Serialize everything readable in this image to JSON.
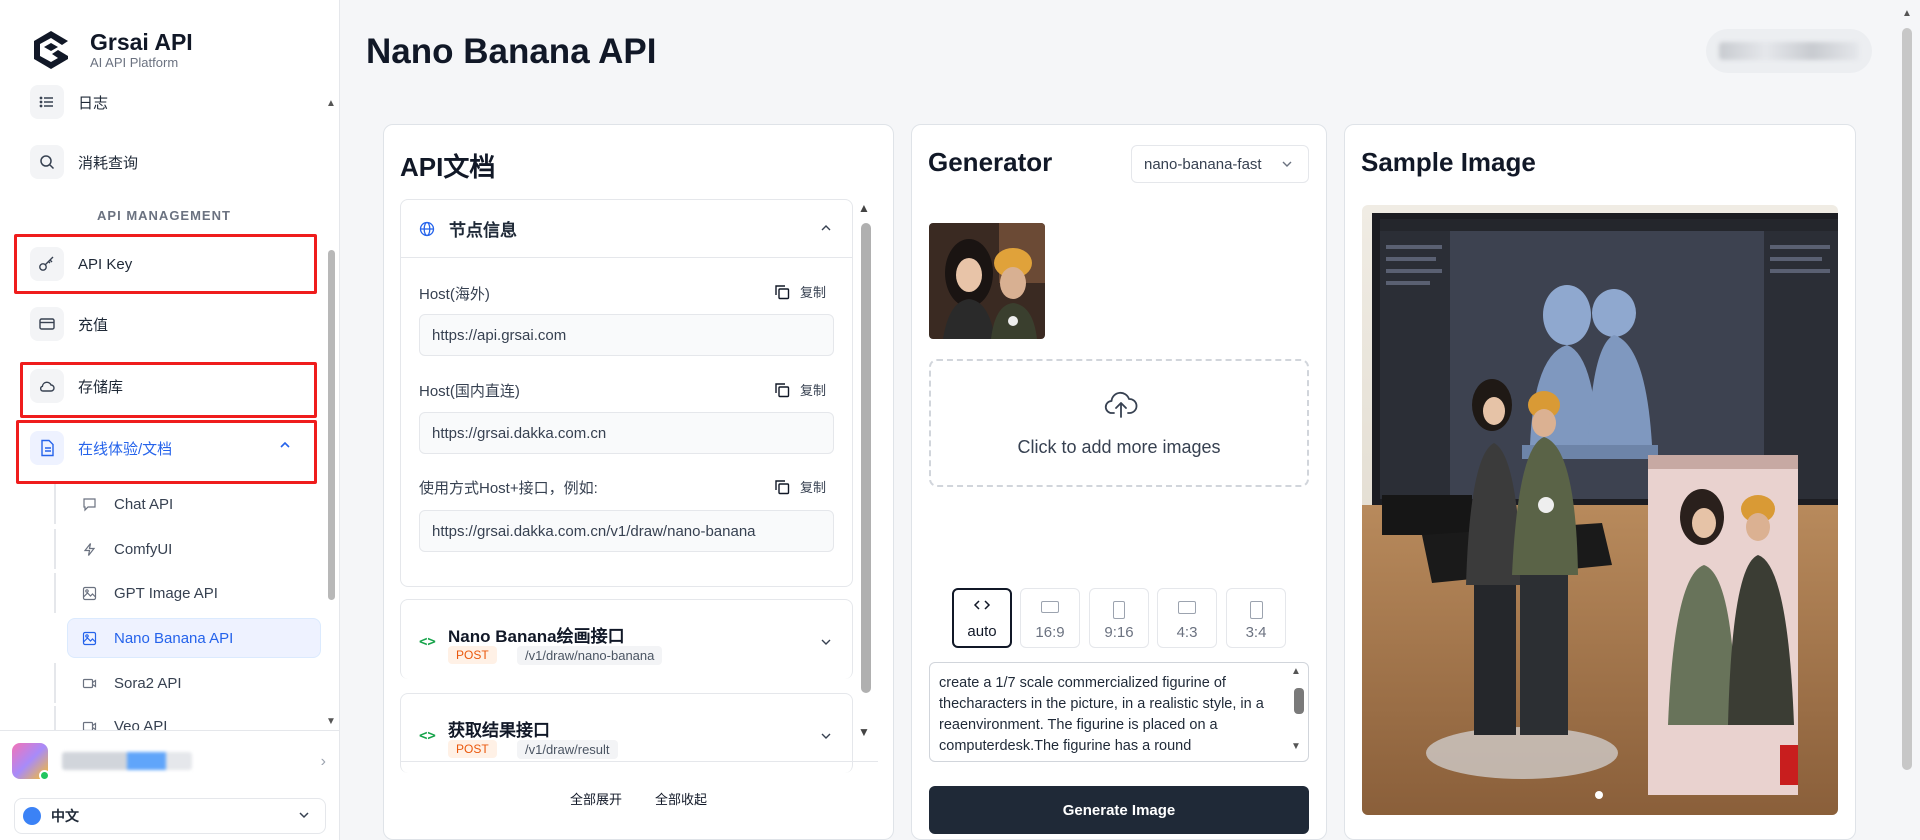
{
  "brand": {
    "title": "Grsai API",
    "subtitle": "AI API Platform"
  },
  "sidebar": {
    "items": [
      {
        "label": "日志",
        "icon": "list-icon"
      },
      {
        "label": "消耗查询",
        "icon": "search-icon"
      }
    ],
    "section_title": "API MANAGEMENT",
    "mgmt_items": [
      {
        "label": "API Key",
        "icon": "key-icon"
      },
      {
        "label": "充值",
        "icon": "credit-card-icon"
      },
      {
        "label": "存储库",
        "icon": "cloud-icon"
      },
      {
        "label": "在线体验/文档",
        "icon": "document-icon",
        "active": true,
        "expanded": true
      }
    ],
    "sub_items": [
      {
        "label": "Chat API",
        "icon": "chat-icon"
      },
      {
        "label": "ComfyUI",
        "icon": "bolt-icon"
      },
      {
        "label": "GPT Image API",
        "icon": "image-icon"
      },
      {
        "label": "Nano Banana API",
        "icon": "image-icon",
        "active": true
      },
      {
        "label": "Sora2 API",
        "icon": "video-icon"
      },
      {
        "label": "Veo API",
        "icon": "video-icon"
      }
    ],
    "language": "中文"
  },
  "header": {
    "title": "Nano Banana API"
  },
  "doc": {
    "title": "API文档",
    "node_title": "节点信息",
    "copy_label": "复制",
    "fields": [
      {
        "label": "Host(海外)",
        "value": "https://api.grsai.com"
      },
      {
        "label": "Host(国内直连)",
        "value": "https://grsai.dakka.com.cn"
      },
      {
        "label": "使用方式Host+接口，例如:",
        "value": "https://grsai.dakka.com.cn/v1/draw/nano-banana"
      }
    ],
    "endpoints": [
      {
        "title": "Nano Banana绘画接口",
        "method": "POST",
        "path": "/v1/draw/nano-banana"
      },
      {
        "title": "获取结果接口",
        "method": "POST",
        "path": "/v1/draw/result"
      }
    ],
    "expand_all": "全部展开",
    "collapse_all": "全部收起"
  },
  "generator": {
    "title": "Generator",
    "model": "nano-banana-fast",
    "upload_text": "Click to add more images",
    "ratios": [
      "auto",
      "16:9",
      "9:16",
      "4:3",
      "3:4"
    ],
    "selected_ratio": "auto",
    "prompt": "create a 1/7 scale commercialized figurine of thecharacters in the picture, in a realistic style, in a reaenvironment. The figurine is placed on a computerdesk.The figurine has a round",
    "button": "Generate Image"
  },
  "sample": {
    "title": "Sample Image"
  },
  "colors": {
    "accent": "#2563eb",
    "highlight": "#ef1c1c",
    "button": "#1f2937"
  }
}
